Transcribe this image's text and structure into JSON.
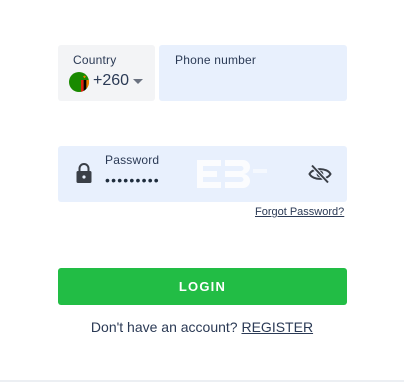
{
  "country": {
    "label": "Country",
    "code": "+260",
    "flag_icon": "zambia-flag-icon",
    "dropdown_icon": "caret-down-icon"
  },
  "phone": {
    "label": "Phone number",
    "value": "",
    "placeholder": ""
  },
  "password": {
    "label": "Password",
    "masked_value": "•••••••••",
    "lock_icon": "lock-icon",
    "visibility_icon": "eye-off-icon"
  },
  "links": {
    "forgot_password": "Forgot Password?"
  },
  "login": {
    "label": "LOGIN"
  },
  "register": {
    "prompt": "Don't have an account? ",
    "link_label": "REGISTER"
  },
  "colors": {
    "login_button": "#22bd45",
    "field_background": "#e8f0fd",
    "country_background": "#f3f4f6",
    "text": "#2b3a55"
  }
}
